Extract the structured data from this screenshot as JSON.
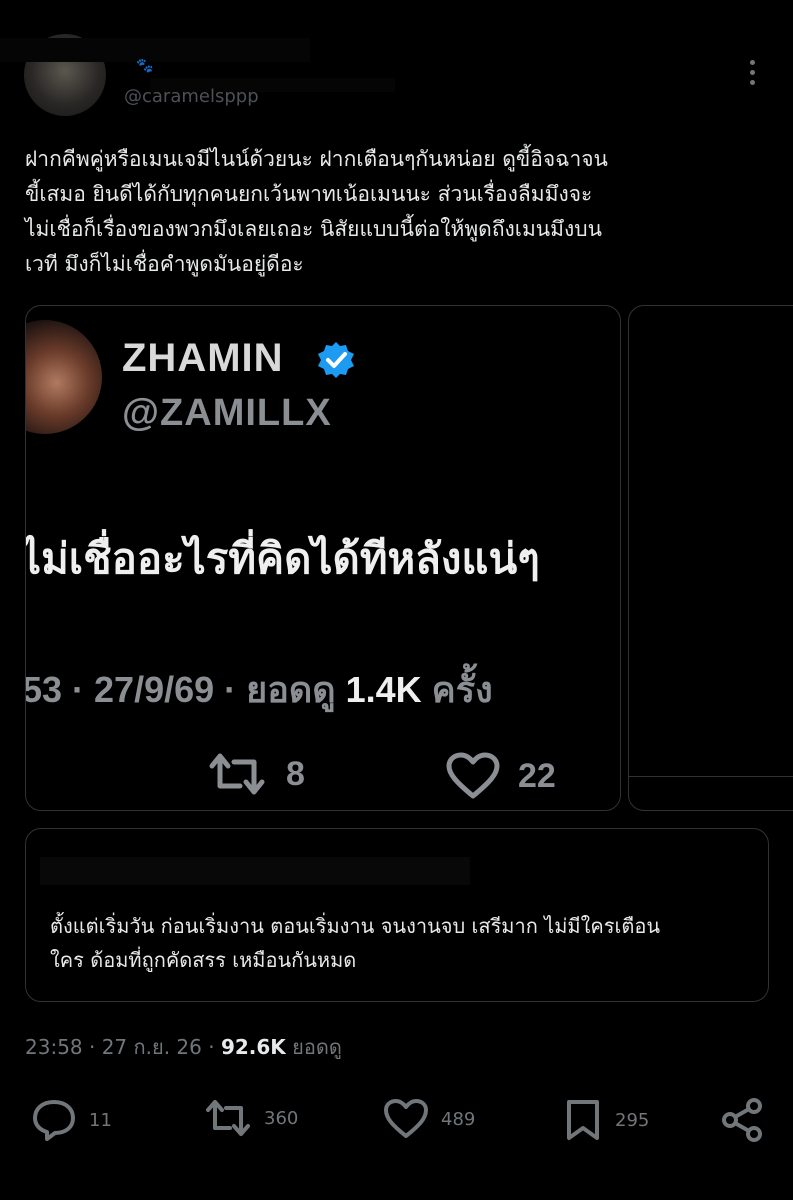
{
  "header": {
    "handle": "@caramelsppp"
  },
  "tweet": {
    "lines": [
      "ฝากคีพคู่หรือเมนเจมีไนน์ด้วยนะ ฝากเตือนๆกันหน่อย ดูขี้อิจฉาจน",
      "ขี้เสมอ ยินดีได้กับทุกคนยกเว้นพาทเน้อเมนนะ ส่วนเรื่องลืมมึงจะ",
      "ไม่เชื่อก็เรื่องของพวกมึงเลยเถอะ นิสัยแบบนี้ต่อให้พูดถึงเมนมึงบน",
      "เวที มึงก็ไม่เชื่อคำพูดมันอยู่ดีอะ"
    ]
  },
  "media": {
    "name": "ZHAMIN",
    "handle": "@ZAMILLX",
    "quote": "ไม่เชื่ออะไรที่คิดได้ทีหลังแน่ๆ",
    "meta_prefix": "53 · 27/9/69 · ยอดดู ",
    "meta_views": "1.4K",
    "meta_suffix": " ครั้ง",
    "retweets": "8",
    "likes": "22"
  },
  "quoted": {
    "lines": [
      "ตั้งแต่เริ่มวัน ก่อนเริ่มงาน ตอนเริ่มงาน จนงานจบ เสรีมาก ไม่มีใครเตือน",
      "ใคร ด้อมที่ถูกคัดสรร เหมือนกันหมด"
    ]
  },
  "meta": {
    "time": "23:58 · 27 ก.ย. 26 · ",
    "views": "92.6K",
    "views_label": " ยอดดู"
  },
  "actions": {
    "replies": "11",
    "retweets": "360",
    "likes": "489",
    "bookmarks": "295"
  },
  "colors": {
    "background": "#000000",
    "text": "#e7e9ea",
    "muted": "#71767b",
    "verified": "#1d9bf0"
  }
}
